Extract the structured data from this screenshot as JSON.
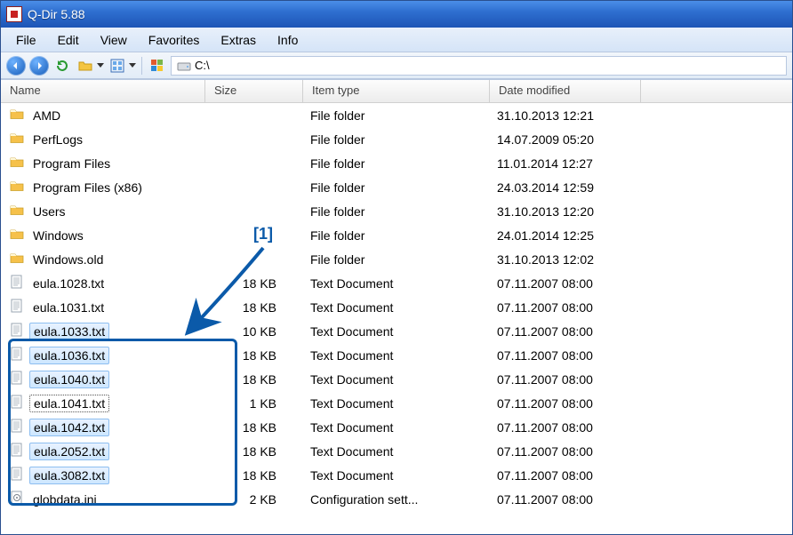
{
  "window": {
    "title": "Q-Dir 5.88"
  },
  "menu": [
    "File",
    "Edit",
    "View",
    "Favorites",
    "Extras",
    "Info"
  ],
  "toolbar": {
    "path": "C:\\"
  },
  "columns": {
    "name": "Name",
    "size": "Size",
    "type": "Item type",
    "date": "Date modified"
  },
  "annotation": {
    "label": "[1]"
  },
  "rows": [
    {
      "icon": "folder",
      "name": "AMD",
      "size": "",
      "type": "File folder",
      "date": "31.10.2013 12:21",
      "sel": false,
      "foc": false
    },
    {
      "icon": "folder",
      "name": "PerfLogs",
      "size": "",
      "type": "File folder",
      "date": "14.07.2009 05:20",
      "sel": false,
      "foc": false
    },
    {
      "icon": "folder",
      "name": "Program Files",
      "size": "",
      "type": "File folder",
      "date": "11.01.2014 12:27",
      "sel": false,
      "foc": false
    },
    {
      "icon": "folder",
      "name": "Program Files (x86)",
      "size": "",
      "type": "File folder",
      "date": "24.03.2014 12:59",
      "sel": false,
      "foc": false
    },
    {
      "icon": "folder",
      "name": "Users",
      "size": "",
      "type": "File folder",
      "date": "31.10.2013 12:20",
      "sel": false,
      "foc": false
    },
    {
      "icon": "folder",
      "name": "Windows",
      "size": "",
      "type": "File folder",
      "date": "24.01.2014 12:25",
      "sel": false,
      "foc": false
    },
    {
      "icon": "folder",
      "name": "Windows.old",
      "size": "",
      "type": "File folder",
      "date": "31.10.2013 12:02",
      "sel": false,
      "foc": false
    },
    {
      "icon": "txt",
      "name": "eula.1028.txt",
      "size": "18 KB",
      "type": "Text Document",
      "date": "07.11.2007 08:00",
      "sel": false,
      "foc": false
    },
    {
      "icon": "txt",
      "name": "eula.1031.txt",
      "size": "18 KB",
      "type": "Text Document",
      "date": "07.11.2007 08:00",
      "sel": false,
      "foc": false
    },
    {
      "icon": "txt",
      "name": "eula.1033.txt",
      "size": "10 KB",
      "type": "Text Document",
      "date": "07.11.2007 08:00",
      "sel": true,
      "foc": false
    },
    {
      "icon": "txt",
      "name": "eula.1036.txt",
      "size": "18 KB",
      "type": "Text Document",
      "date": "07.11.2007 08:00",
      "sel": true,
      "foc": false
    },
    {
      "icon": "txt",
      "name": "eula.1040.txt",
      "size": "18 KB",
      "type": "Text Document",
      "date": "07.11.2007 08:00",
      "sel": true,
      "foc": false
    },
    {
      "icon": "txt",
      "name": "eula.1041.txt",
      "size": "1 KB",
      "type": "Text Document",
      "date": "07.11.2007 08:00",
      "sel": false,
      "foc": true
    },
    {
      "icon": "txt",
      "name": "eula.1042.txt",
      "size": "18 KB",
      "type": "Text Document",
      "date": "07.11.2007 08:00",
      "sel": true,
      "foc": false
    },
    {
      "icon": "txt",
      "name": "eula.2052.txt",
      "size": "18 KB",
      "type": "Text Document",
      "date": "07.11.2007 08:00",
      "sel": true,
      "foc": false
    },
    {
      "icon": "txt",
      "name": "eula.3082.txt",
      "size": "18 KB",
      "type": "Text Document",
      "date": "07.11.2007 08:00",
      "sel": true,
      "foc": false
    },
    {
      "icon": "ini",
      "name": "globdata.ini",
      "size": "2 KB",
      "type": "Configuration sett...",
      "date": "07.11.2007 08:00",
      "sel": false,
      "foc": false
    }
  ]
}
